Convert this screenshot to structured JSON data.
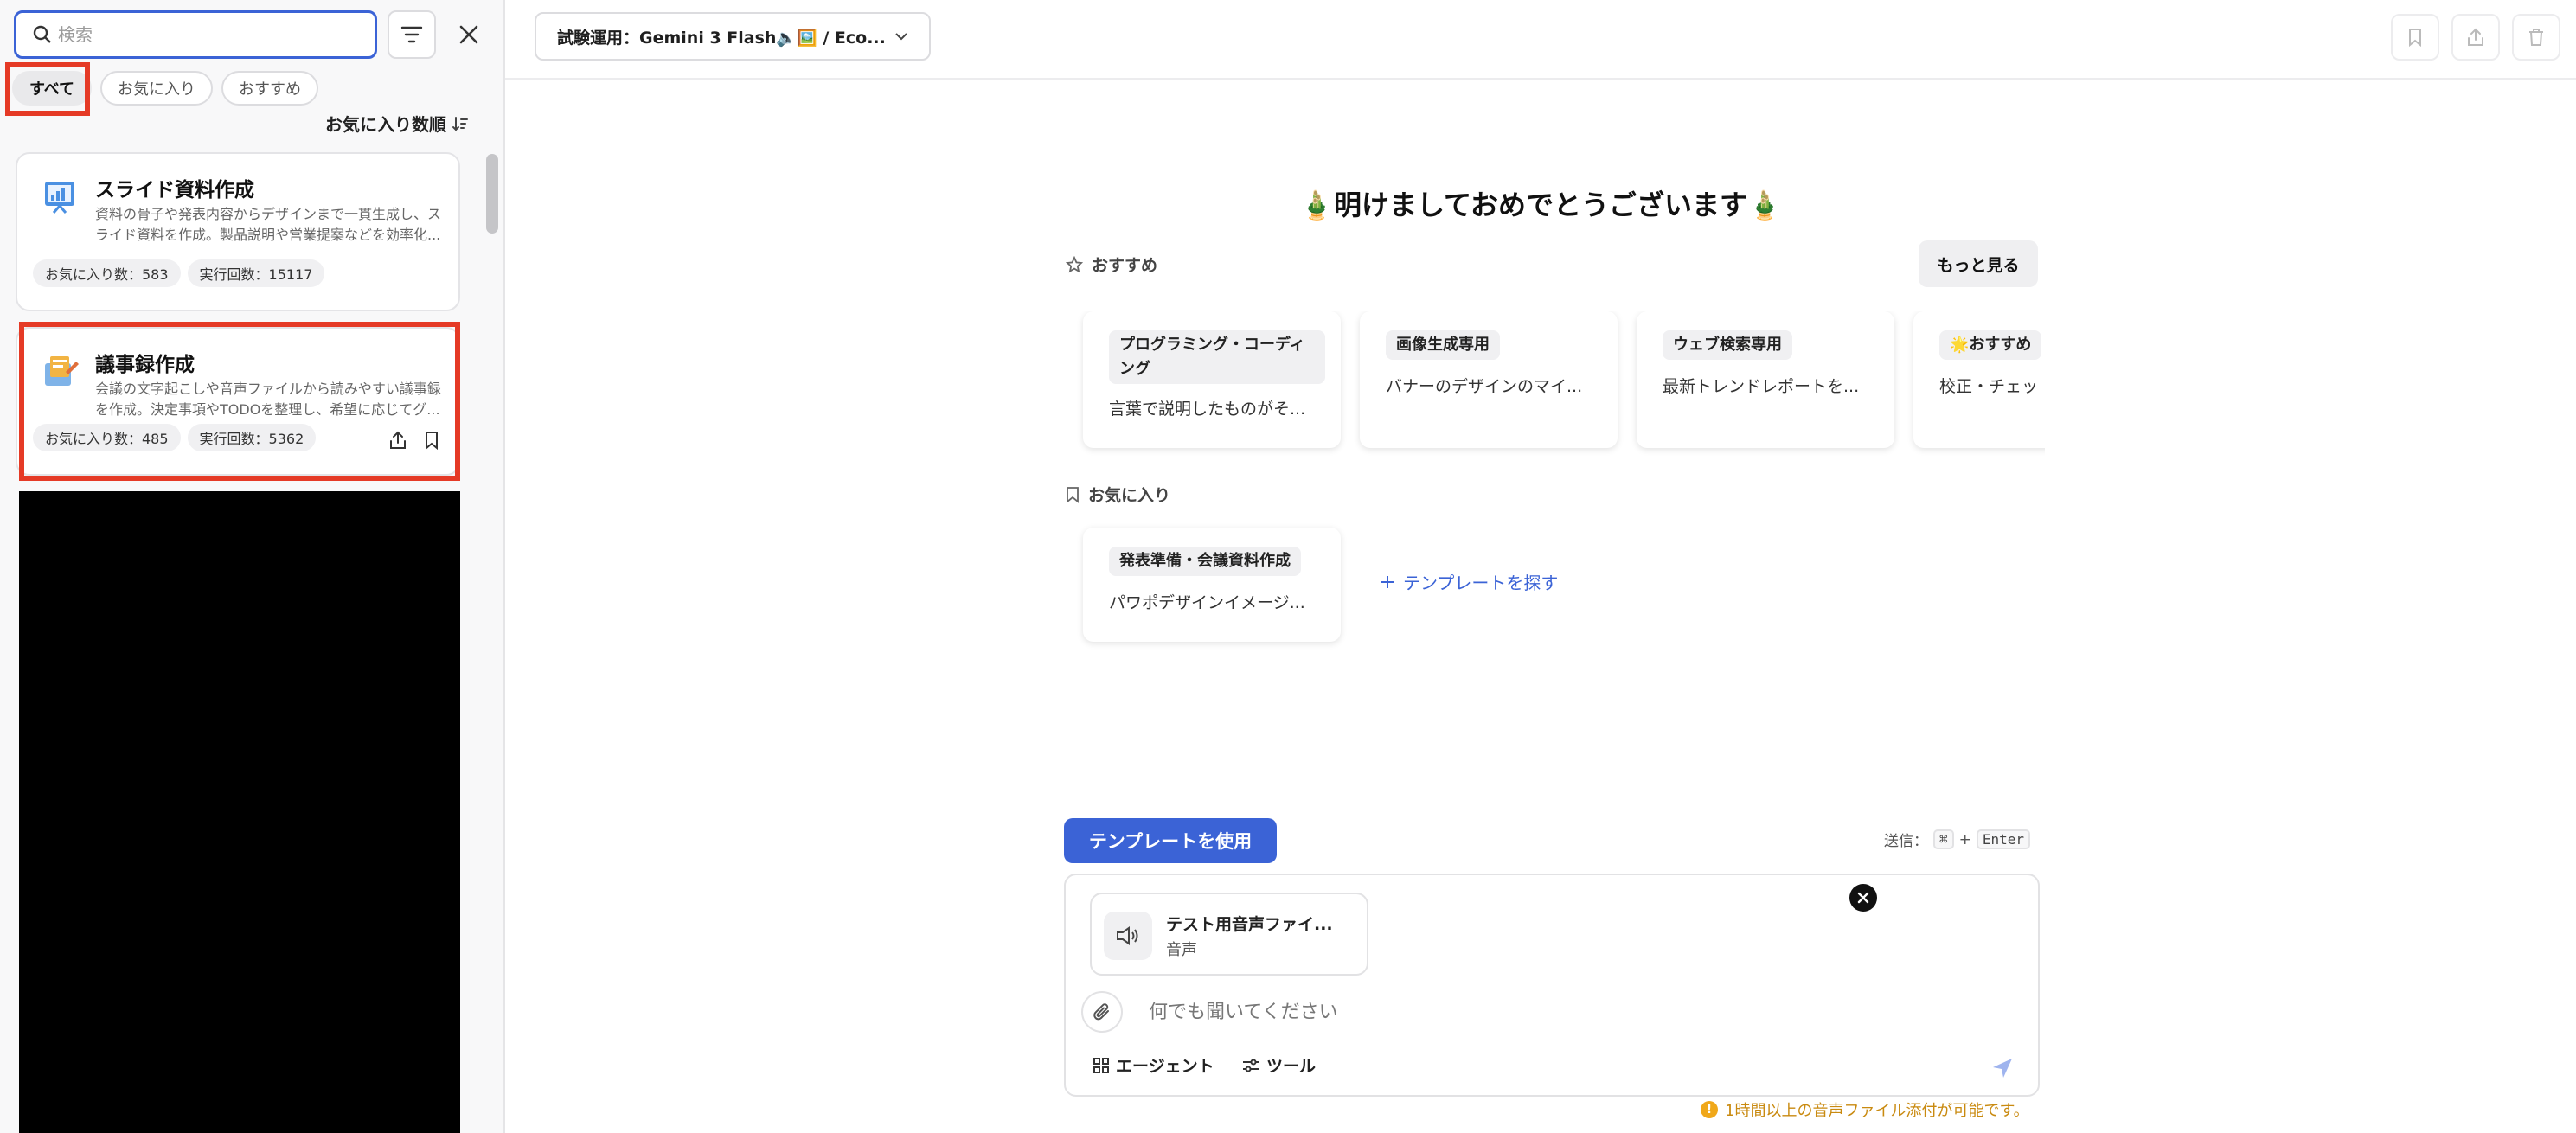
{
  "sidebar": {
    "search": {
      "placeholder": "検索",
      "value": ""
    },
    "filters": [
      {
        "label": "すべて",
        "active": true
      },
      {
        "label": "お気に入り",
        "active": false
      },
      {
        "label": "おすすめ",
        "active": false
      }
    ],
    "sort_label": "お気に入り数順",
    "templates": [
      {
        "title": "スライド資料作成",
        "description": "資料の骨子や発表内容からデザインまで一貫生成し、スライド資料を作成。製品説明や営業提案などを効率化...",
        "favorites": "お気に入り数：583",
        "runs": "実行回数：15117",
        "icon": "slides-icon"
      },
      {
        "title": "議事録作成",
        "description": "会議の文字起こしや音声ファイルから読みやすい議事録を作成。決定事項やTODOを整理し、希望に応じてグ...",
        "favorites": "お気に入り数：485",
        "runs": "実行回数：5362",
        "icon": "minutes-icon"
      }
    ]
  },
  "header": {
    "model_selector": "試験運用：Gemini 3 Flash🔈🖼️ / Eco...",
    "actions": [
      "bookmark-icon",
      "share-icon",
      "trash-icon"
    ]
  },
  "main": {
    "greeting": "🎍明けましておめでとうございます🎍",
    "recommended": {
      "label": "おすすめ",
      "more_button": "もっと見る",
      "cards": [
        {
          "tag": "プログラミング・コーディング",
          "text": "言葉で説明したものがそ..."
        },
        {
          "tag": "画像生成専用",
          "text": "バナーのデザインのマイ..."
        },
        {
          "tag": "ウェブ検索専用",
          "text": "最新トレンドレポートを..."
        },
        {
          "tag": "🌟おすすめ",
          "text": "校正・チェッ"
        }
      ]
    },
    "favorites": {
      "label": "お気に入り",
      "cards": [
        {
          "tag": "発表準備・会議資料作成",
          "text": "パワポデザインイメージ..."
        }
      ],
      "find_link": "テンプレートを探す"
    },
    "use_template_button": "テンプレートを使用",
    "send_hint": {
      "label": "送信：",
      "key1": "⌘",
      "plus": "+",
      "key2": "Enter"
    },
    "composer": {
      "attachment": {
        "name": "テスト用音声ファイ...",
        "type": "音声"
      },
      "placeholder": "何でも聞いてください",
      "agent_label": "エージェント",
      "tool_label": "ツール"
    },
    "warning": "1時間以上の音声ファイル添付が可能です。"
  },
  "colors": {
    "accent": "#3b63d6",
    "highlight": "#e53a26",
    "warning": "#c98a10"
  }
}
